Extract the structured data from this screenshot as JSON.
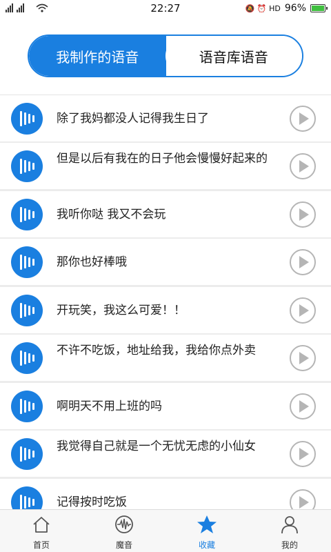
{
  "status": {
    "left_indicators": "3G 4G",
    "time": "22:27",
    "right_icons": "🔕 ⏰ HD",
    "battery": "96%"
  },
  "tabs": {
    "mine": "我制作的语音",
    "library": "语音库语音"
  },
  "items": [
    {
      "text": "除了我妈都没人记得我生日了"
    },
    {
      "text": "但是以后有我在的日子他会慢慢好起来的"
    },
    {
      "text": "我听你哒 我又不会玩"
    },
    {
      "text": "那你也好棒哦"
    },
    {
      "text": "开玩笑，我这么可爱！！"
    },
    {
      "text": "不许不吃饭，地址给我，我给你点外卖"
    },
    {
      "text": "啊明天不用上班的吗"
    },
    {
      "text": "我觉得自己就是一个无忧无虑的小仙女"
    },
    {
      "text": "记得按时吃饭"
    }
  ],
  "nav": {
    "home": "首页",
    "magic": "魔音",
    "favorites": "收藏",
    "mine": "我的"
  },
  "colors": {
    "accent": "#1a7fe0",
    "play_gray": "#b5b5b5"
  }
}
